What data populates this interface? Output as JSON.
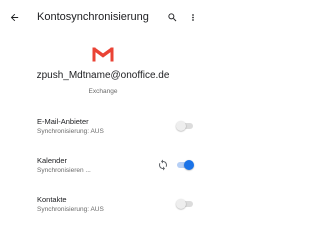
{
  "toolbar": {
    "title": "Kontosynchronisierung",
    "back_icon": "arrow-back-icon",
    "search_icon": "search-icon",
    "more_icon": "more-vert-icon"
  },
  "account": {
    "logo_icon": "gmail-icon",
    "email": "zpush_Mdtname@onoffice.de",
    "type": "Exchange"
  },
  "sync_items": [
    {
      "title": "E-Mail-Anbieter",
      "subtitle": "Synchronisierung: AUS",
      "enabled": false
    },
    {
      "title": "Kalender",
      "subtitle": "Synchronisieren ...",
      "enabled": true,
      "syncing_icon": "sync-icon"
    },
    {
      "title": "Kontakte",
      "subtitle": "Synchronisierung: AUS",
      "enabled": false
    }
  ],
  "colors": {
    "accent": "#1a73e8",
    "gmail_red": "#ea4335",
    "text_primary": "#202124",
    "text_secondary": "#6b6b6b"
  }
}
